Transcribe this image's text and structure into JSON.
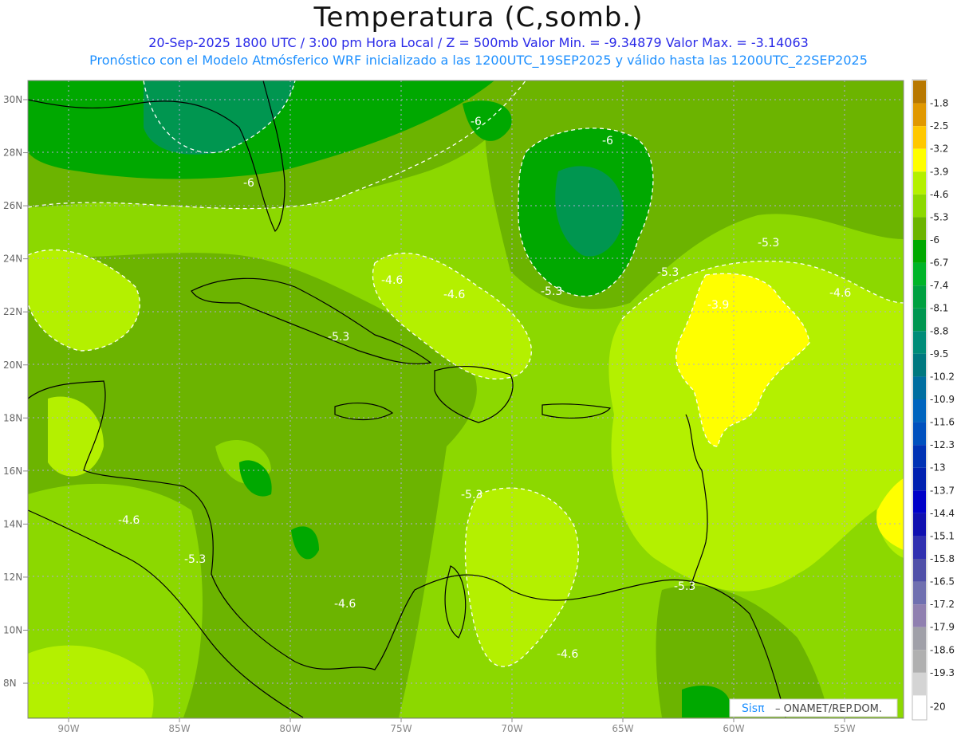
{
  "header": {
    "title": "Temperatura (C,somb.)",
    "subtitle_1": "20-Sep-2025  1800 UTC / 3:00 pm Hora Local / Z = 500mb  Valor Min. = -9.34879  Valor Max. = -3.14063",
    "subtitle_2": "Pronóstico con el Modelo Atmósferico WRF inicializado a las 1200UTC_19SEP2025 y válido hasta las  1200UTC_22SEP2025"
  },
  "map": {
    "lat_labels": [
      "30N",
      "28N",
      "26N",
      "24N",
      "22N",
      "20N",
      "18N",
      "16N",
      "14N",
      "12N",
      "10N",
      "8N"
    ],
    "lon_labels": [
      "90W",
      "85W",
      "80W",
      "75W",
      "70W",
      "65W",
      "60W",
      "55W"
    ],
    "contour_labels": [
      "-6",
      "-6",
      "-6",
      "-5.3",
      "-4.6",
      "-4.6",
      "-5.3",
      "-5.3",
      "-5.3",
      "-3.9",
      "-4.6",
      "-5.3",
      "-4.6",
      "-5.3",
      "-4.6",
      "-5.3",
      "-4.6"
    ],
    "colors": {
      "dark_green": "#00a800",
      "deep_green": "#009650",
      "olive": "#6cb400",
      "yellow_green": "#8cd800",
      "lime": "#b4f000",
      "yellow": "#ffff00"
    }
  },
  "colorbar": {
    "labels": [
      "-1.8",
      "-2.5",
      "-3.2",
      "-3.9",
      "-4.6",
      "-5.3",
      "-6",
      "-6.7",
      "-7.4",
      "-8.1",
      "-8.8",
      "-9.5",
      "-10.2",
      "-10.9",
      "-11.6",
      "-12.3",
      "-13",
      "-13.7",
      "-14.4",
      "-15.1",
      "-15.8",
      "-16.5",
      "-17.2",
      "-17.9",
      "-18.6",
      "-19.3",
      "-20"
    ],
    "colors": [
      "#b87800",
      "#e09800",
      "#ffc800",
      "#ffff00",
      "#b4f000",
      "#8cd800",
      "#6cb400",
      "#00a800",
      "#00b428",
      "#00a040",
      "#009650",
      "#008c78",
      "#00787f",
      "#006ea0",
      "#0064be",
      "#0050be",
      "#0032b4",
      "#0020b0",
      "#0000c8",
      "#1010b0",
      "#3030b0",
      "#5050a8",
      "#7070b0",
      "#9080b0",
      "#a0a0a8",
      "#b0b0b0",
      "#d4d4d4",
      "#ffffff"
    ]
  },
  "credit": {
    "logo": "Sisπ",
    "text": "– ONAMET/REP.DOM."
  }
}
